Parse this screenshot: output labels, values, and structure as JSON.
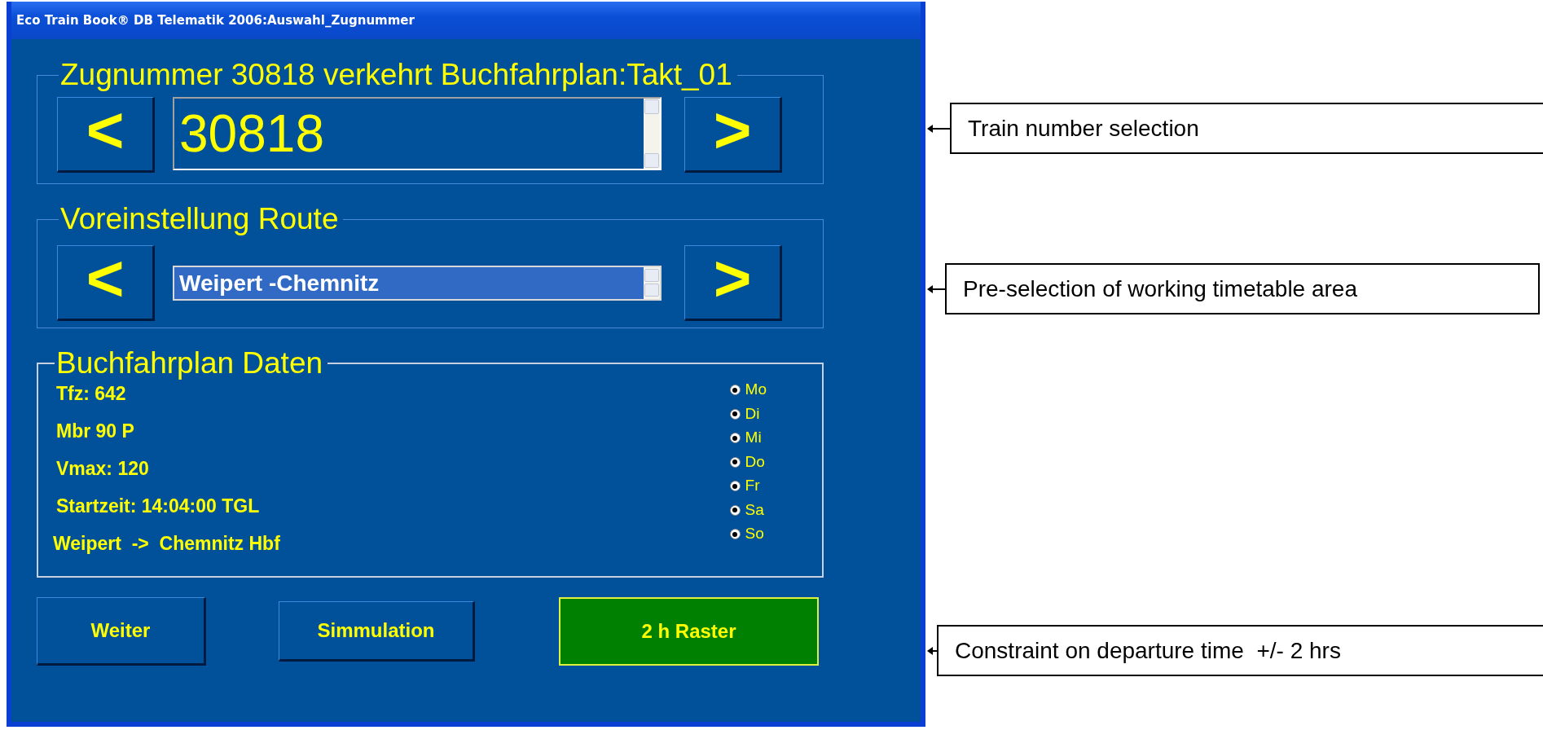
{
  "window": {
    "title": "Eco Train Book® DB Telematik 2006:Auswahl_Zugnummer"
  },
  "train_group": {
    "legend": "Zugnummer 30818 verkehrt Buchfahrplan:Takt_01",
    "prev": "<",
    "value": "30818",
    "next": ">"
  },
  "route_group": {
    "legend": "Voreinstellung Route",
    "prev": "<",
    "items": [
      {
        "label": "Weipert -Chemnitz",
        "selected": true
      }
    ],
    "next": ">"
  },
  "data_group": {
    "legend": "Buchfahrplan Daten",
    "lines": [
      "Tfz: 642",
      "Mbr 90 P",
      "Vmax: 120",
      "Startzeit: 14:04:00 TGL",
      "Weipert  ->  Chemnitz Hbf"
    ],
    "days": [
      {
        "label": "Mo",
        "checked": true
      },
      {
        "label": "Di",
        "checked": true
      },
      {
        "label": "Mi",
        "checked": true
      },
      {
        "label": "Do",
        "checked": true
      },
      {
        "label": "Fr",
        "checked": true
      },
      {
        "label": "Sa",
        "checked": true
      },
      {
        "label": "So",
        "checked": true
      }
    ]
  },
  "buttons": [
    {
      "label": "Weiter",
      "active": false
    },
    {
      "label": "Simmulation",
      "active": false
    },
    {
      "label": "2 h Raster",
      "active": true
    }
  ],
  "annotations": [
    "Train number selection",
    "Pre-selection of working timetable area",
    "Constraint on departure time  +/- 2 hrs"
  ]
}
